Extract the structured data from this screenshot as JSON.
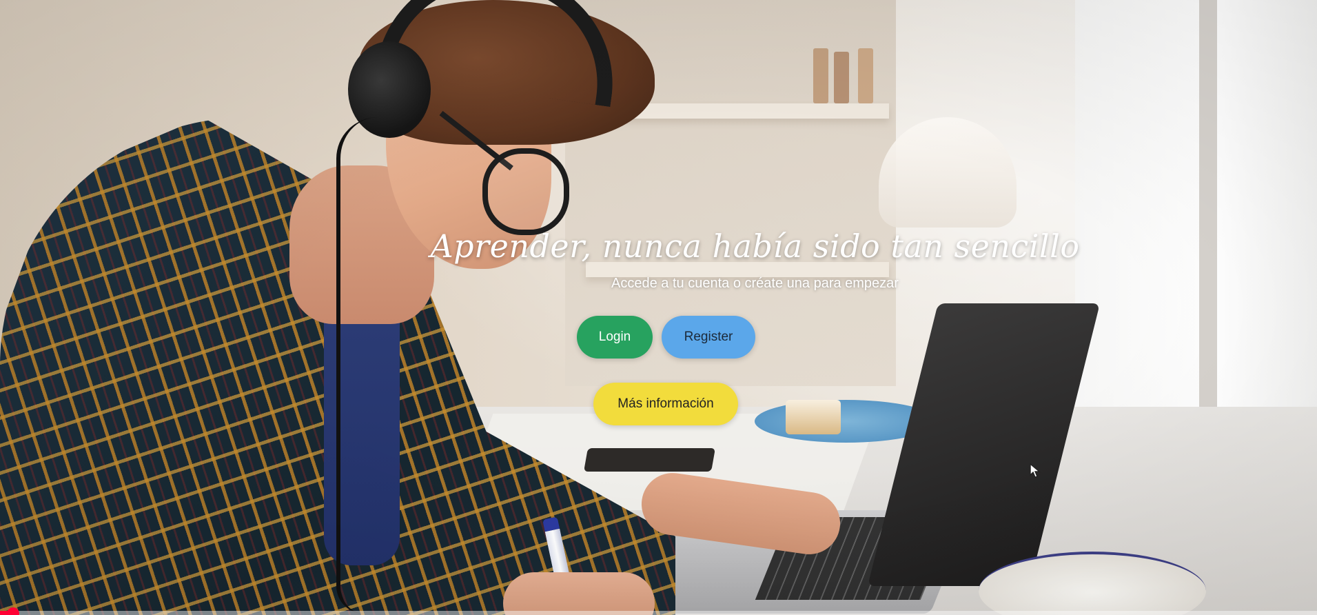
{
  "hero": {
    "title": "Aprender, nunca había sido tan sencillo",
    "subtitle": "Accede a tu cuenta o créate una para empezar"
  },
  "actions": {
    "login_label": "Login",
    "register_label": "Register",
    "info_label": "Más información"
  },
  "colors": {
    "login": "#27a25f",
    "register": "#5ba7ea",
    "info": "#f2dc3c",
    "title_text": "#ffffff",
    "progress": "#ff0033"
  },
  "background": {
    "description_icon": "student-with-headphones-photo"
  },
  "cursor": {
    "icon": "mouse-pointer-icon"
  },
  "video_progress": {
    "fraction": 0.01
  }
}
